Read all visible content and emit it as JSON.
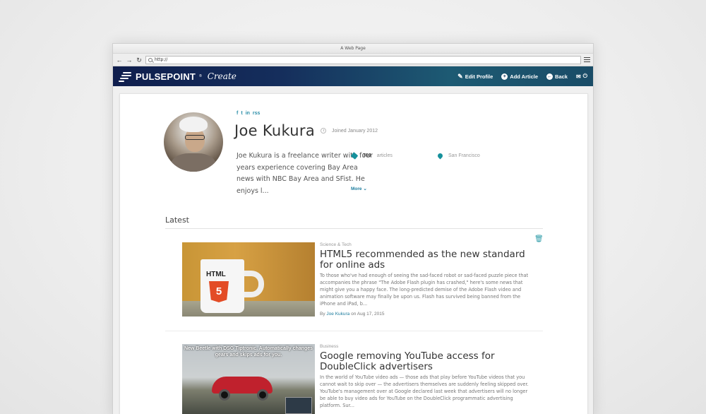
{
  "browser": {
    "window_title": "A Web Page",
    "url": "http://",
    "nav": {
      "back": "←",
      "forward": "→",
      "reload": "↻"
    }
  },
  "header": {
    "logo_text": "PULSEPOINT",
    "logo_reg": "®",
    "logo_sub": "Create",
    "actions": {
      "edit_profile": "Edit Profile",
      "add_article": "Add Article",
      "back": "Back"
    }
  },
  "profile": {
    "social": [
      "f",
      "t",
      "in",
      "rss"
    ],
    "name": "Joe Kukura",
    "joined": "Joined January 2012",
    "bio": "Joe Kukura is a freelance writer with four years experience covering Bay Area news with NBC Bay Area and SFist. He enjoys l...",
    "more_label": "More",
    "articles_count": "709",
    "articles_label": "articles",
    "location": "San Francisco"
  },
  "latest": {
    "heading": "Latest",
    "articles": [
      {
        "category": "Science & Tech",
        "title": "HTML5 recommended as the new standard for online ads",
        "excerpt": "To those who've had enough of seeing the sad-faced robot or sad-faced puzzle piece that accompanies the phrase \"The Adobe Flash plugin has crashed,\" here's some news that might give you a happy face. The long-predicted demise of the Adobe Flash video and animation software may finally be upon us. Flash has survived being banned from the iPhone and iPad, b...",
        "by": "By",
        "author": "Joe Kukura",
        "date": "on Aug 17, 2015",
        "thumb_text": "HTML",
        "thumb_badge": "5"
      },
      {
        "category": "Business",
        "title": "Google removing YouTube access for DoubleClick advertisers",
        "excerpt": "In the world of YouTube video ads — those ads that play before YouTube videos that you cannot wait to skip over — the advertisers themselves are suddenly feeling skipped over. YouTube's management over at Google declared last week that advertisers will no longer be able to buy video ads for YouTube on the DoubleClick programmatic advertising platform. Sur...",
        "thumb_caption": "New Beetle with DSG Tiptronic. Automatically changes gears and skips ads for you."
      }
    ]
  },
  "colors": {
    "accent": "#16919c",
    "link": "#1e7d9e",
    "header_start": "#0f1e4d",
    "header_end": "#1d5a73"
  }
}
